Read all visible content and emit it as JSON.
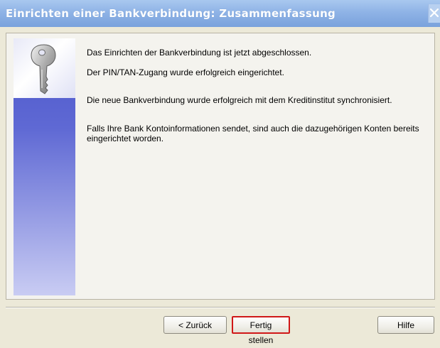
{
  "window": {
    "title": "Einrichten einer Bankverbindung: Zusammenfassung"
  },
  "sidebar": {
    "icon": "key-icon"
  },
  "summary": {
    "line1": "Das Einrichten der Bankverbindung ist jetzt abgeschlossen.",
    "line2": "Der PIN/TAN-Zugang wurde erfolgreich eingerichtet.",
    "line3": "Die neue Bankverbindung wurde erfolgreich mit dem Kreditinstitut synchronisiert.",
    "line4": "Falls Ihre Bank Kontoinformationen sendet, sind auch die dazugehörigen Konten bereits eingerichtet worden."
  },
  "buttons": {
    "back_label": "< Zurück",
    "finish_label": "Fertig stellen",
    "help_label": "Hilfe"
  },
  "colors": {
    "highlight": "#d01818",
    "sidebar_top": "#4a55c9",
    "sidebar_bottom": "#c9ccf3"
  }
}
